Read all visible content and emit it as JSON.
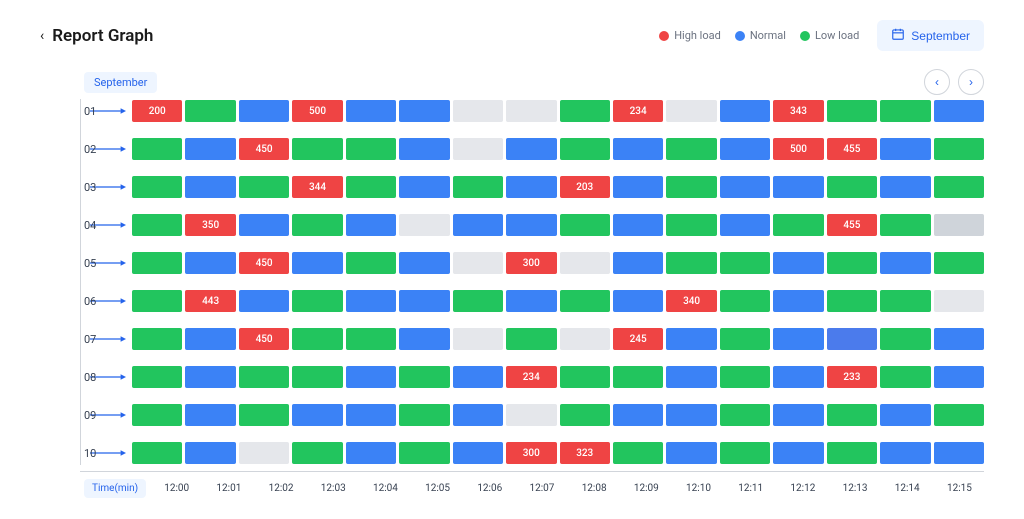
{
  "header": {
    "title": "Report Graph",
    "back_icon": "chevron-left",
    "month_button": "September"
  },
  "legend": [
    {
      "label": "High load",
      "color": "#ef4444"
    },
    {
      "label": "Normal",
      "color": "#3b82f6"
    },
    {
      "label": "Low load",
      "color": "#22c55e"
    }
  ],
  "topbar": {
    "month_pill": "September"
  },
  "xaxis": {
    "label": "Time(min)",
    "ticks": [
      "12:00",
      "12:01",
      "12:02",
      "12:03",
      "12:04",
      "12:05",
      "12:06",
      "12:07",
      "12:08",
      "12:09",
      "12:10",
      "12:11",
      "12:12",
      "12:13",
      "12:14",
      "12:15"
    ]
  },
  "chart_data": {
    "type": "heatmap",
    "title": "Report Graph",
    "xlabel": "Time(min)",
    "ylabel": "",
    "x": [
      "12:00",
      "12:01",
      "12:02",
      "12:03",
      "12:04",
      "12:05",
      "12:06",
      "12:07",
      "12:08",
      "12:09",
      "12:10",
      "12:11",
      "12:12",
      "12:13",
      "12:14",
      "12:15"
    ],
    "y": [
      "01",
      "02",
      "03",
      "04",
      "05",
      "06",
      "07",
      "08",
      "09",
      "10"
    ],
    "legend": {
      "high": "High load",
      "normal": "Normal",
      "low": "Low load"
    },
    "colors": {
      "high": "#ef4444",
      "normal": "#3b82f6",
      "low": "#22c55e",
      "empty": "#e5e7eb"
    },
    "rows": [
      {
        "id": "01",
        "cells": [
          {
            "s": "high",
            "v": 200
          },
          {
            "s": "low"
          },
          {
            "s": "normal"
          },
          {
            "s": "high",
            "v": 500
          },
          {
            "s": "normal"
          },
          {
            "s": "normal"
          },
          {
            "s": "empty"
          },
          {
            "s": "empty"
          },
          {
            "s": "low"
          },
          {
            "s": "high",
            "v": 234
          },
          {
            "s": "empty"
          },
          {
            "s": "normal"
          },
          {
            "s": "high",
            "v": 343
          },
          {
            "s": "low"
          },
          {
            "s": "low"
          },
          {
            "s": "normal"
          }
        ]
      },
      {
        "id": "02",
        "cells": [
          {
            "s": "low"
          },
          {
            "s": "normal"
          },
          {
            "s": "high",
            "v": 450
          },
          {
            "s": "low"
          },
          {
            "s": "low"
          },
          {
            "s": "normal"
          },
          {
            "s": "empty"
          },
          {
            "s": "normal"
          },
          {
            "s": "low"
          },
          {
            "s": "normal"
          },
          {
            "s": "low"
          },
          {
            "s": "normal"
          },
          {
            "s": "high",
            "v": 500
          },
          {
            "s": "high",
            "v": 455
          },
          {
            "s": "normal"
          },
          {
            "s": "low"
          }
        ]
      },
      {
        "id": "03",
        "cells": [
          {
            "s": "low"
          },
          {
            "s": "normal"
          },
          {
            "s": "low"
          },
          {
            "s": "high",
            "v": 344
          },
          {
            "s": "low"
          },
          {
            "s": "normal"
          },
          {
            "s": "low"
          },
          {
            "s": "normal"
          },
          {
            "s": "high",
            "v": 203
          },
          {
            "s": "normal"
          },
          {
            "s": "low"
          },
          {
            "s": "normal"
          },
          {
            "s": "normal"
          },
          {
            "s": "low"
          },
          {
            "s": "normal"
          },
          {
            "s": "low"
          }
        ]
      },
      {
        "id": "04",
        "cells": [
          {
            "s": "low"
          },
          {
            "s": "high",
            "v": 350
          },
          {
            "s": "normal"
          },
          {
            "s": "low"
          },
          {
            "s": "normal"
          },
          {
            "s": "empty"
          },
          {
            "s": "normal"
          },
          {
            "s": "normal"
          },
          {
            "s": "low"
          },
          {
            "s": "normal"
          },
          {
            "s": "low"
          },
          {
            "s": "normal"
          },
          {
            "s": "low"
          },
          {
            "s": "high",
            "v": 455
          },
          {
            "s": "low"
          },
          {
            "s": "empty2"
          }
        ]
      },
      {
        "id": "05",
        "cells": [
          {
            "s": "low"
          },
          {
            "s": "normal"
          },
          {
            "s": "high",
            "v": 450
          },
          {
            "s": "normal"
          },
          {
            "s": "low"
          },
          {
            "s": "normal"
          },
          {
            "s": "empty"
          },
          {
            "s": "high",
            "v": 300
          },
          {
            "s": "empty"
          },
          {
            "s": "normal"
          },
          {
            "s": "low"
          },
          {
            "s": "low"
          },
          {
            "s": "normal"
          },
          {
            "s": "low"
          },
          {
            "s": "normal"
          },
          {
            "s": "low"
          }
        ]
      },
      {
        "id": "06",
        "cells": [
          {
            "s": "low"
          },
          {
            "s": "high",
            "v": 443
          },
          {
            "s": "normal"
          },
          {
            "s": "low"
          },
          {
            "s": "normal"
          },
          {
            "s": "normal"
          },
          {
            "s": "low"
          },
          {
            "s": "normal"
          },
          {
            "s": "low"
          },
          {
            "s": "normal"
          },
          {
            "s": "high",
            "v": 340
          },
          {
            "s": "low"
          },
          {
            "s": "normal"
          },
          {
            "s": "low"
          },
          {
            "s": "low"
          },
          {
            "s": "empty"
          }
        ]
      },
      {
        "id": "07",
        "cells": [
          {
            "s": "low"
          },
          {
            "s": "normal"
          },
          {
            "s": "high",
            "v": 450
          },
          {
            "s": "low"
          },
          {
            "s": "low"
          },
          {
            "s": "normal"
          },
          {
            "s": "empty"
          },
          {
            "s": "low"
          },
          {
            "s": "empty"
          },
          {
            "s": "high",
            "v": 245
          },
          {
            "s": "normal"
          },
          {
            "s": "low"
          },
          {
            "s": "normal"
          },
          {
            "s": "normal2"
          },
          {
            "s": "low"
          },
          {
            "s": "normal"
          }
        ]
      },
      {
        "id": "08",
        "cells": [
          {
            "s": "low"
          },
          {
            "s": "normal"
          },
          {
            "s": "low"
          },
          {
            "s": "low"
          },
          {
            "s": "normal"
          },
          {
            "s": "low"
          },
          {
            "s": "normal"
          },
          {
            "s": "high",
            "v": 234
          },
          {
            "s": "low"
          },
          {
            "s": "low"
          },
          {
            "s": "normal"
          },
          {
            "s": "low"
          },
          {
            "s": "normal"
          },
          {
            "s": "high",
            "v": 233
          },
          {
            "s": "low"
          },
          {
            "s": "normal"
          }
        ]
      },
      {
        "id": "09",
        "cells": [
          {
            "s": "low"
          },
          {
            "s": "normal"
          },
          {
            "s": "low"
          },
          {
            "s": "normal"
          },
          {
            "s": "normal"
          },
          {
            "s": "low"
          },
          {
            "s": "normal"
          },
          {
            "s": "empty"
          },
          {
            "s": "low"
          },
          {
            "s": "normal"
          },
          {
            "s": "normal"
          },
          {
            "s": "low"
          },
          {
            "s": "normal"
          },
          {
            "s": "low"
          },
          {
            "s": "normal"
          },
          {
            "s": "low"
          }
        ]
      },
      {
        "id": "10",
        "cells": [
          {
            "s": "low"
          },
          {
            "s": "normal"
          },
          {
            "s": "empty"
          },
          {
            "s": "low"
          },
          {
            "s": "normal"
          },
          {
            "s": "low"
          },
          {
            "s": "normal"
          },
          {
            "s": "high",
            "v": 300
          },
          {
            "s": "high",
            "v": 323
          },
          {
            "s": "low"
          },
          {
            "s": "normal"
          },
          {
            "s": "low"
          },
          {
            "s": "normal"
          },
          {
            "s": "low"
          },
          {
            "s": "normal"
          },
          {
            "s": "normal"
          }
        ]
      }
    ]
  }
}
